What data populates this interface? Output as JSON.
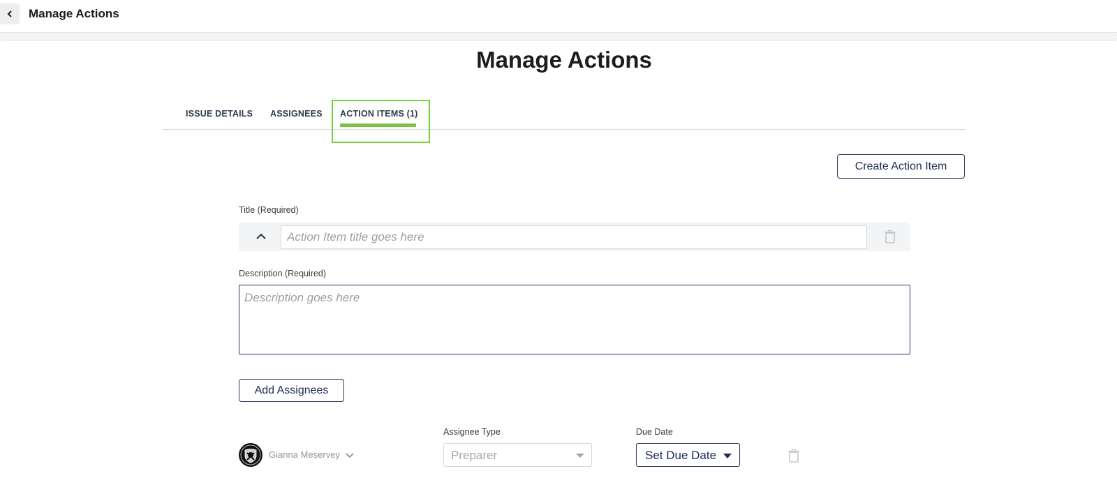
{
  "topbar": {
    "title": "Manage Actions",
    "back_icon": "chevron-left-icon"
  },
  "page": {
    "title": "Manage Actions"
  },
  "tabs": [
    {
      "label": "ISSUE DETAILS",
      "active": false
    },
    {
      "label": "ASSIGNEES",
      "active": false
    },
    {
      "label": "ACTION ITEMS (1)",
      "active": true
    }
  ],
  "colors": {
    "accent": "#7bc043",
    "highlight_border": "#74d13a",
    "primary": "#2d3561"
  },
  "actions": {
    "create_label": "Create Action Item"
  },
  "form": {
    "title_label": "Title (Required)",
    "title_placeholder": "Action Item title goes here",
    "title_value": "",
    "description_label": "Description (Required)",
    "description_placeholder": "Description goes here",
    "description_value": "",
    "add_assignees_label": "Add Assignees"
  },
  "assignee": {
    "name": "Gianna Meservey",
    "avatar_icon": "raiders-logo",
    "type_label": "Assignee Type",
    "type_value": "Preparer",
    "due_label": "Due Date",
    "due_value": "Set Due Date"
  }
}
